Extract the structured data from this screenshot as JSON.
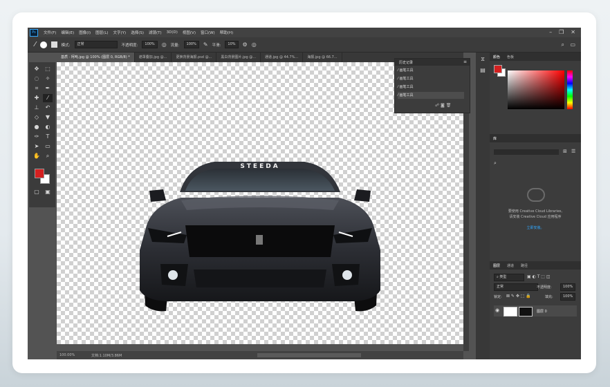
{
  "menu": {
    "logo": "Ps",
    "items": [
      "文件(F)",
      "编辑(E)",
      "图像(I)",
      "图层(L)",
      "文字(Y)",
      "选择(S)",
      "滤镜(T)",
      "3D(D)",
      "视图(V)",
      "窗口(W)",
      "帮助(H)"
    ]
  },
  "options": {
    "mode_label": "模式:",
    "mode_value": "正常",
    "opacity_label": "不透明度:",
    "opacity_value": "100%",
    "flow_label": "流量:",
    "flow_value": "100%",
    "smooth_label": "平滑:",
    "smooth_value": "10%"
  },
  "tabs": [
    {
      "label": "基质 · 柯吨.jpg @ 100% (图层 0, RGB/8) *"
    },
    {
      "label": "遮罩叠加.jpg @..."
    },
    {
      "label": "更换背景海报.psd @..."
    },
    {
      "label": "黑白背景图片.jpg @..."
    },
    {
      "label": "通道.jpg @ 44.7%..."
    },
    {
      "label": "海报.jpg @ 66.7..."
    }
  ],
  "history": {
    "title": "历史记录",
    "items": [
      "画笔工具",
      "画笔工具",
      "画笔工具",
      "画笔工具"
    ]
  },
  "colors": {
    "foreground": "#d42020",
    "background": "#ffffff",
    "accent": "#31a8ff"
  },
  "right_panel": {
    "color_tabs": [
      "颜色",
      "色板"
    ],
    "libraries_tab": "库",
    "cc_text_1": "要使用 Creative Cloud Libraries,",
    "cc_text_2": "请安装 Creative Cloud 应用程序",
    "cc_link": "立即安装。",
    "layers_tabs": [
      "图层",
      "通道",
      "路径"
    ],
    "kind_filter": "类型",
    "blend_mode": "正常",
    "opacity_label": "不透明度:",
    "opacity_value": "100%",
    "lock_label": "锁定:",
    "fill_label": "填充:",
    "fill_value": "100%",
    "layer_name": "图层 0"
  },
  "status": {
    "zoom": "100.00%",
    "doc_info": "文档:1.10M/3.86M"
  },
  "photo": {
    "brand_text": "STEEDA"
  }
}
